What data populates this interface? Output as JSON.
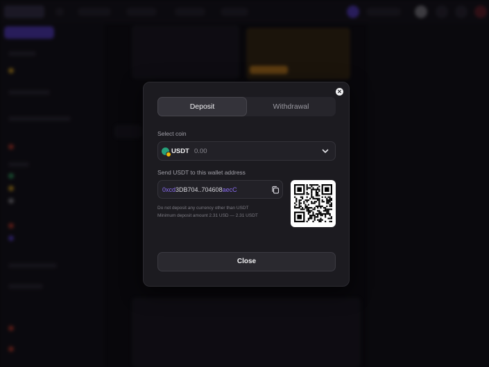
{
  "modal": {
    "tabs": [
      {
        "label": "Deposit",
        "active": true
      },
      {
        "label": "Withdrawal",
        "active": false
      }
    ],
    "select_coin_label": "Select coin",
    "coin": {
      "name": "USDT",
      "balance": "0.00",
      "icon": "tether-coin-icon"
    },
    "send_label": "Send USDT to this wallet address",
    "address": {
      "prefix": "0xcd",
      "middle": "3DB704..704608",
      "suffix": "aecC"
    },
    "qr_code": "deposit-address-qr",
    "notes": [
      "Do not deposit any currency other than USDT",
      "Minimum deposit amount 2.31 USD — 2.31 USDT"
    ],
    "close_label": "Close"
  },
  "colors": {
    "modal_bg": "#1c1b20",
    "accent": "#8a6cf2",
    "coin": "#26a17b"
  }
}
